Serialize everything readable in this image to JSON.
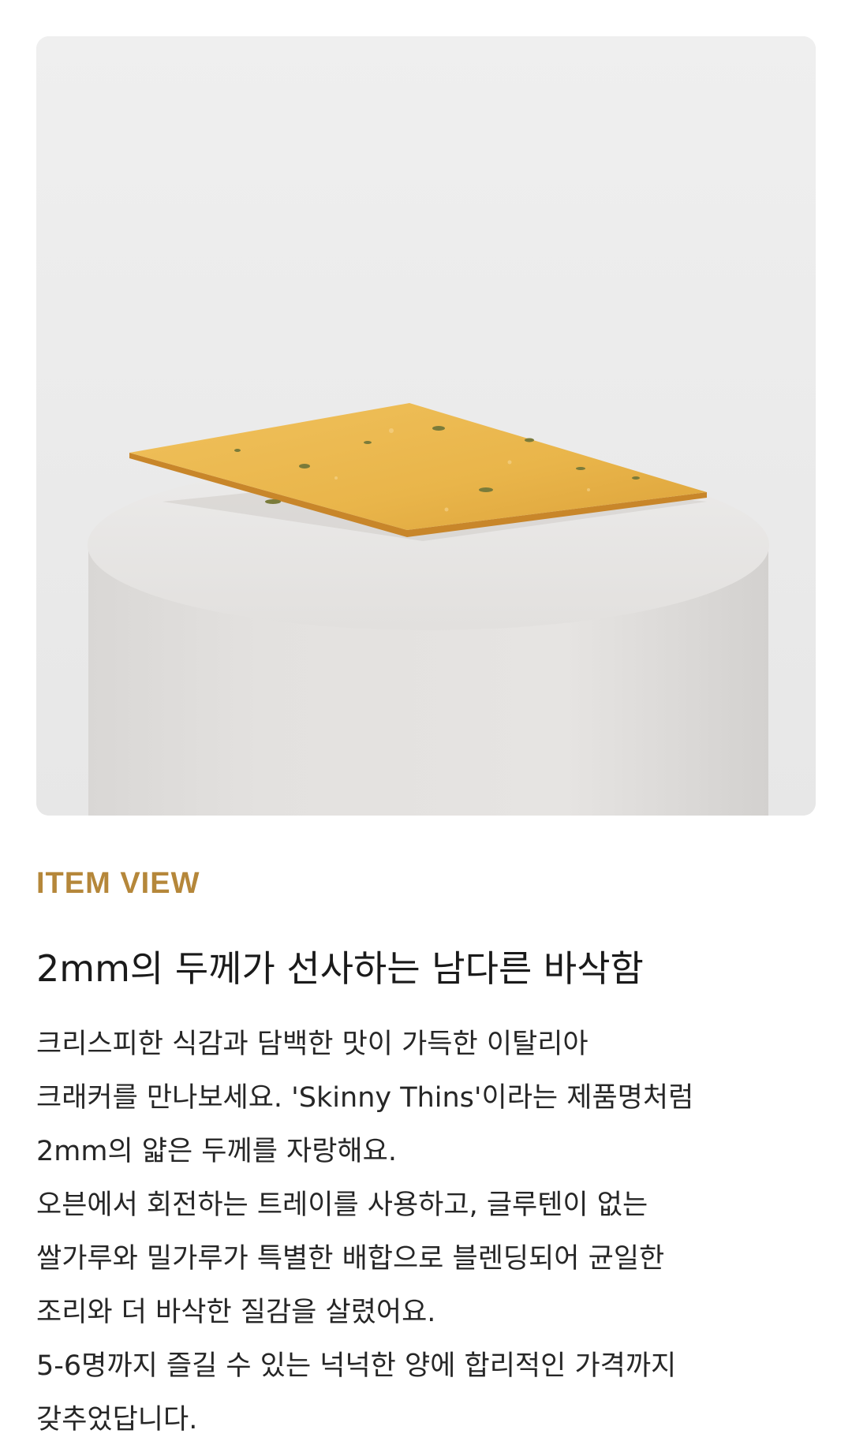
{
  "product_image": {
    "icon": "cracker-on-pedestal-photo",
    "colors": {
      "backdrop": "#ececec",
      "pedestal": "#dedcda",
      "cracker": "#e9b54a",
      "herb": "#7a7b3a"
    }
  },
  "section": {
    "eyebrow": "ITEM VIEW",
    "eyebrow_color": "#b5873a",
    "headline": "2mm의 두께가 선사하는 남다른 바삭함",
    "body_lines": [
      "크리스피한 식감과 담백한 맛이 가득한 이탈리아",
      "크래커를 만나보세요. 'Skinny Thins'이라는 제품명처럼",
      "2mm의 얇은 두께를 자랑해요.",
      "오븐에서 회전하는 트레이를 사용하고,  글루텐이 없는",
      "쌀가루와 밀가루가 특별한 배합으로 블렌딩되어 균일한",
      "조리와 더 바삭한 질감을 살렸어요.",
      "5-6명까지 즐길 수 있는 넉넉한 양에 합리적인 가격까지",
      "갖추었답니다."
    ]
  }
}
